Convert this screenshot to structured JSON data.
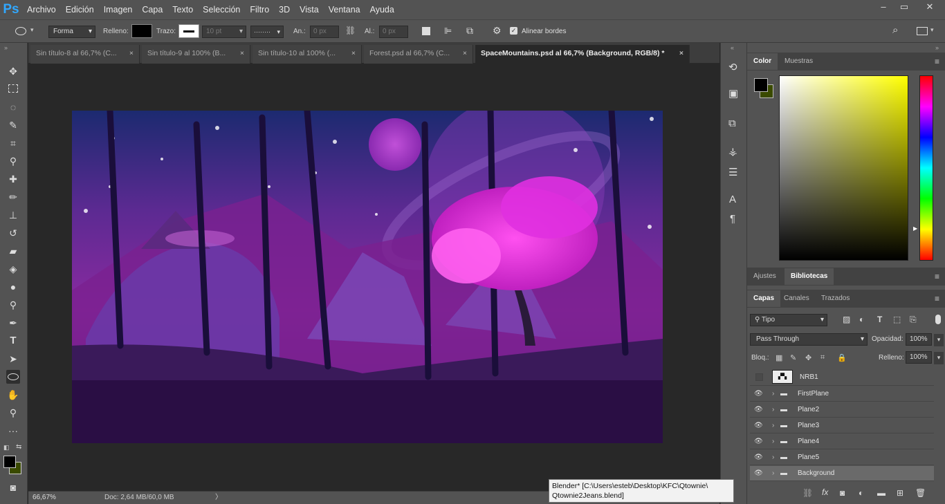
{
  "app": {
    "logo": "Ps"
  },
  "menu": [
    "Archivo",
    "Edición",
    "Imagen",
    "Capa",
    "Texto",
    "Selección",
    "Filtro",
    "3D",
    "Vista",
    "Ventana",
    "Ayuda"
  ],
  "window_controls": [
    "–",
    "▭",
    "✕"
  ],
  "options": {
    "shape_mode": "Forma",
    "fill_label": "Relleno:",
    "stroke_label": "Trazo:",
    "stroke_size": "10 pt",
    "width_label": "An.:",
    "width_value": "0 px",
    "height_label": "Al.:",
    "height_value": "0 px",
    "align_edges": "Alinear bordes"
  },
  "tabs": [
    {
      "label": "Sin título-8 al 66,7% (C...",
      "close": "×"
    },
    {
      "label": "Sin título-9 al 100% (B...",
      "close": "×"
    },
    {
      "label": "Sin título-10 al 100% (...",
      "close": "×"
    },
    {
      "label": "Forest.psd al 66,7% (C...",
      "close": "×"
    },
    {
      "label": "SpaceMountains.psd al 66,7% (Background, RGB/8) *",
      "close": "×"
    }
  ],
  "status": {
    "zoom": "66,67%",
    "doc": "Doc: 2,64 MB/60,0 MB",
    "arrow": "〉"
  },
  "color_panel": {
    "tabs": [
      "Color",
      "Muestras"
    ],
    "foreground": "#000000",
    "background": "#3a4a00"
  },
  "adjust_panel": {
    "tabs": [
      "Ajustes",
      "Bibliotecas"
    ]
  },
  "layers_panel": {
    "tabs": [
      "Capas",
      "Canales",
      "Trazados"
    ],
    "filter": "Tipo",
    "blend_mode": "Pass Through",
    "opacity_label": "Opacidad:",
    "opacity_value": "100%",
    "lock_label": "Bloq.:",
    "fill_label": "Relleno:",
    "fill_value": "100%",
    "layers": [
      {
        "name": "NRB1",
        "type": "smart",
        "visible": false
      },
      {
        "name": "FirstPlane",
        "type": "group",
        "visible": true
      },
      {
        "name": "Plane2",
        "type": "group",
        "visible": true
      },
      {
        "name": "Plane3",
        "type": "group",
        "visible": true
      },
      {
        "name": "Plane4",
        "type": "group",
        "visible": true
      },
      {
        "name": "Plane5",
        "type": "group",
        "visible": true
      },
      {
        "name": "Background",
        "type": "group",
        "visible": true,
        "selected": true
      }
    ]
  },
  "tooltip": {
    "line1": "Blender* [C:\\Users\\esteb\\Desktop\\KFC\\Qtownie\\",
    "line2": "Qtownie2Jeans.blend]"
  },
  "colors": {
    "ui": "#535353",
    "canvas": "#282828",
    "accent": "#31a8ff"
  }
}
